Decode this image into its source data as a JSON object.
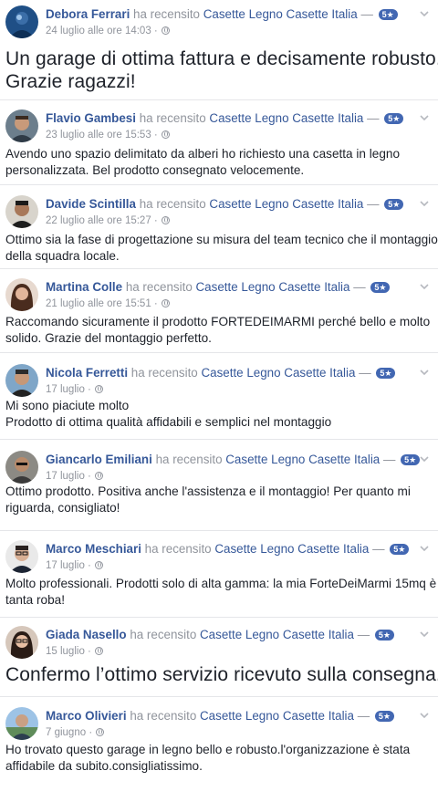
{
  "verb": "ha recensito",
  "page_name": "Casette Legno Casette Italia",
  "dash": "—",
  "rating_badge": "5★",
  "reviews": [
    {
      "name": "Debora Ferrari",
      "date": "24 luglio alle ore 14:03 ·",
      "lines": [
        "Un garage di ottima fattura e decisamente robusto.",
        "Grazie ragazzi!"
      ]
    },
    {
      "name": "Flavio Gambesi",
      "date": "23 luglio alle ore 15:53 ·",
      "lines": [
        "Avendo uno spazio delimitato da alberi ho richiesto una casetta in legno",
        "personalizzata. Bel prodotto consegnato velocemente."
      ]
    },
    {
      "name": "Davide Scintilla",
      "date": "22 luglio alle ore 15:27 ·",
      "lines": [
        "Ottimo sia la fase di progettazione su misura del team tecnico che il montaggio",
        "della squadra locale."
      ]
    },
    {
      "name": "Martina Colle",
      "date": "21 luglio alle ore 15:51 ·",
      "lines": [
        "Raccomando sicuramente il prodotto FORTEDEIMARMI perché bello e molto",
        "solido. Grazie del montaggio perfetto."
      ]
    },
    {
      "name": "Nicola Ferretti",
      "date": "17 luglio ·",
      "lines": [
        "Mi sono piaciute molto",
        "Prodotto di ottima qualità affidabili e semplici nel montaggio"
      ]
    },
    {
      "name": "Giancarlo Emiliani",
      "date": "17 luglio ·",
      "lines": [
        "Ottimo prodotto. Positiva anche l'assistenza e il montaggio! Per quanto mi",
        "riguarda, consigliato!"
      ]
    },
    {
      "name": "Marco Meschiari",
      "date": "17 luglio ·",
      "lines": [
        "Molto professionali. Prodotti solo di alta gamma: la mia ForteDeiMarmi 15mq è",
        "tanta roba!"
      ]
    },
    {
      "name": "Giada Nasello",
      "date": "15 luglio ·",
      "lines": [
        "Confermo l’ottimo servizio ricevuto sulla consegna."
      ]
    },
    {
      "name": "Marco Olivieri",
      "date": "7 giugno ·",
      "lines": [
        "Ho trovato questo garage in legno bello e robusto.l'organizzazione è stata",
        "affidabile da subito.consigliatissimo."
      ]
    }
  ],
  "colors": {
    "link": "#365899",
    "meta": "#90949c",
    "badge": "#4267b2",
    "text": "#1d2129",
    "divider": "#e5e6e9"
  },
  "icons": {
    "privacy": "globe-icon",
    "options": "chevron-down-icon"
  }
}
